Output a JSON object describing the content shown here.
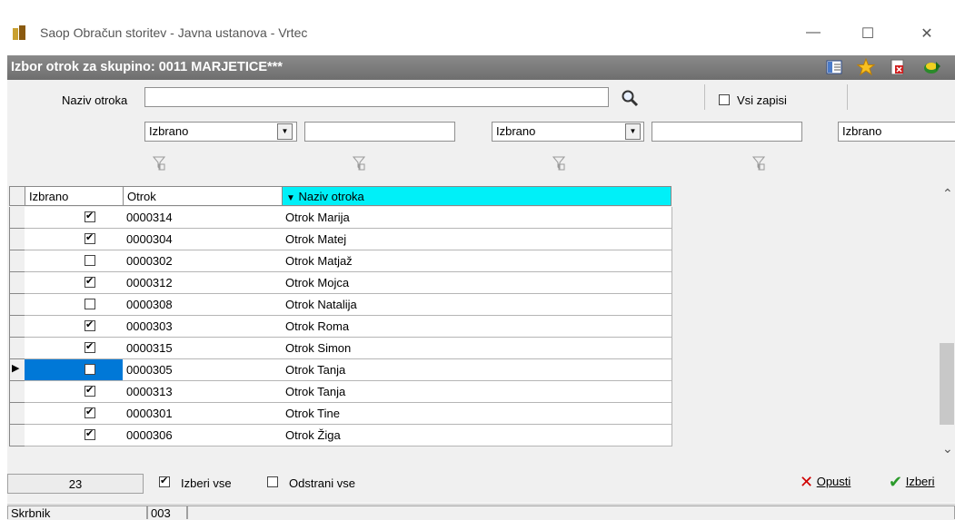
{
  "window": {
    "title": "Saop Obračun storitev - Javna ustanova - Vrtec",
    "min_glyph": "—",
    "max_glyph": "☐",
    "close_glyph": "✕"
  },
  "header": {
    "title": "Izbor otrok za skupino: 0011 MARJETICE***",
    "icons": [
      "columns-icon",
      "star-icon",
      "close-document-icon",
      "exit-icon"
    ]
  },
  "filters": {
    "name_label": "Naziv otroka",
    "name_value": "",
    "all_records_label": "Vsi zapisi",
    "all_records_checked": false,
    "select1_value": "Izbrano",
    "text1_value": "",
    "select2_value": "Izbrano",
    "text2_value": "",
    "select3_value": "Izbrano"
  },
  "grid": {
    "columns": [
      "Izbrano",
      "Otrok",
      "Naziv otroka"
    ],
    "sort_column": "Naziv otroka",
    "rows": [
      {
        "checked": true,
        "code": "0000314",
        "name": "Otrok Marija"
      },
      {
        "checked": true,
        "code": "0000304",
        "name": "Otrok Matej"
      },
      {
        "checked": false,
        "code": "0000302",
        "name": "Otrok Matjaž"
      },
      {
        "checked": true,
        "code": "0000312",
        "name": "Otrok Mojca"
      },
      {
        "checked": false,
        "code": "0000308",
        "name": "Otrok Natalija"
      },
      {
        "checked": true,
        "code": "0000303",
        "name": "Otrok Roma"
      },
      {
        "checked": true,
        "code": "0000315",
        "name": "Otrok Simon"
      },
      {
        "checked": false,
        "code": "0000305",
        "name": "Otrok Tanja",
        "current": true
      },
      {
        "checked": true,
        "code": "0000313",
        "name": "Otrok Tanja"
      },
      {
        "checked": true,
        "code": "0000301",
        "name": "Otrok Tine"
      },
      {
        "checked": true,
        "code": "0000306",
        "name": "Otrok Žiga"
      }
    ]
  },
  "footer": {
    "count": "23",
    "select_all_label": "Izberi vse",
    "select_all_checked": true,
    "remove_all_label": "Odstrani vse",
    "remove_all_checked": false,
    "cancel_label": "Opusti",
    "confirm_label": "Izberi"
  },
  "status": {
    "field_label": "Skrbnik",
    "field_value": "003"
  },
  "colors": {
    "header_bg": "#7a7a7a",
    "sort_header_bg": "#00f0f8",
    "selected_cell": "#0078d7",
    "cancel_red": "#d00000",
    "confirm_green": "#2a9a2a"
  }
}
